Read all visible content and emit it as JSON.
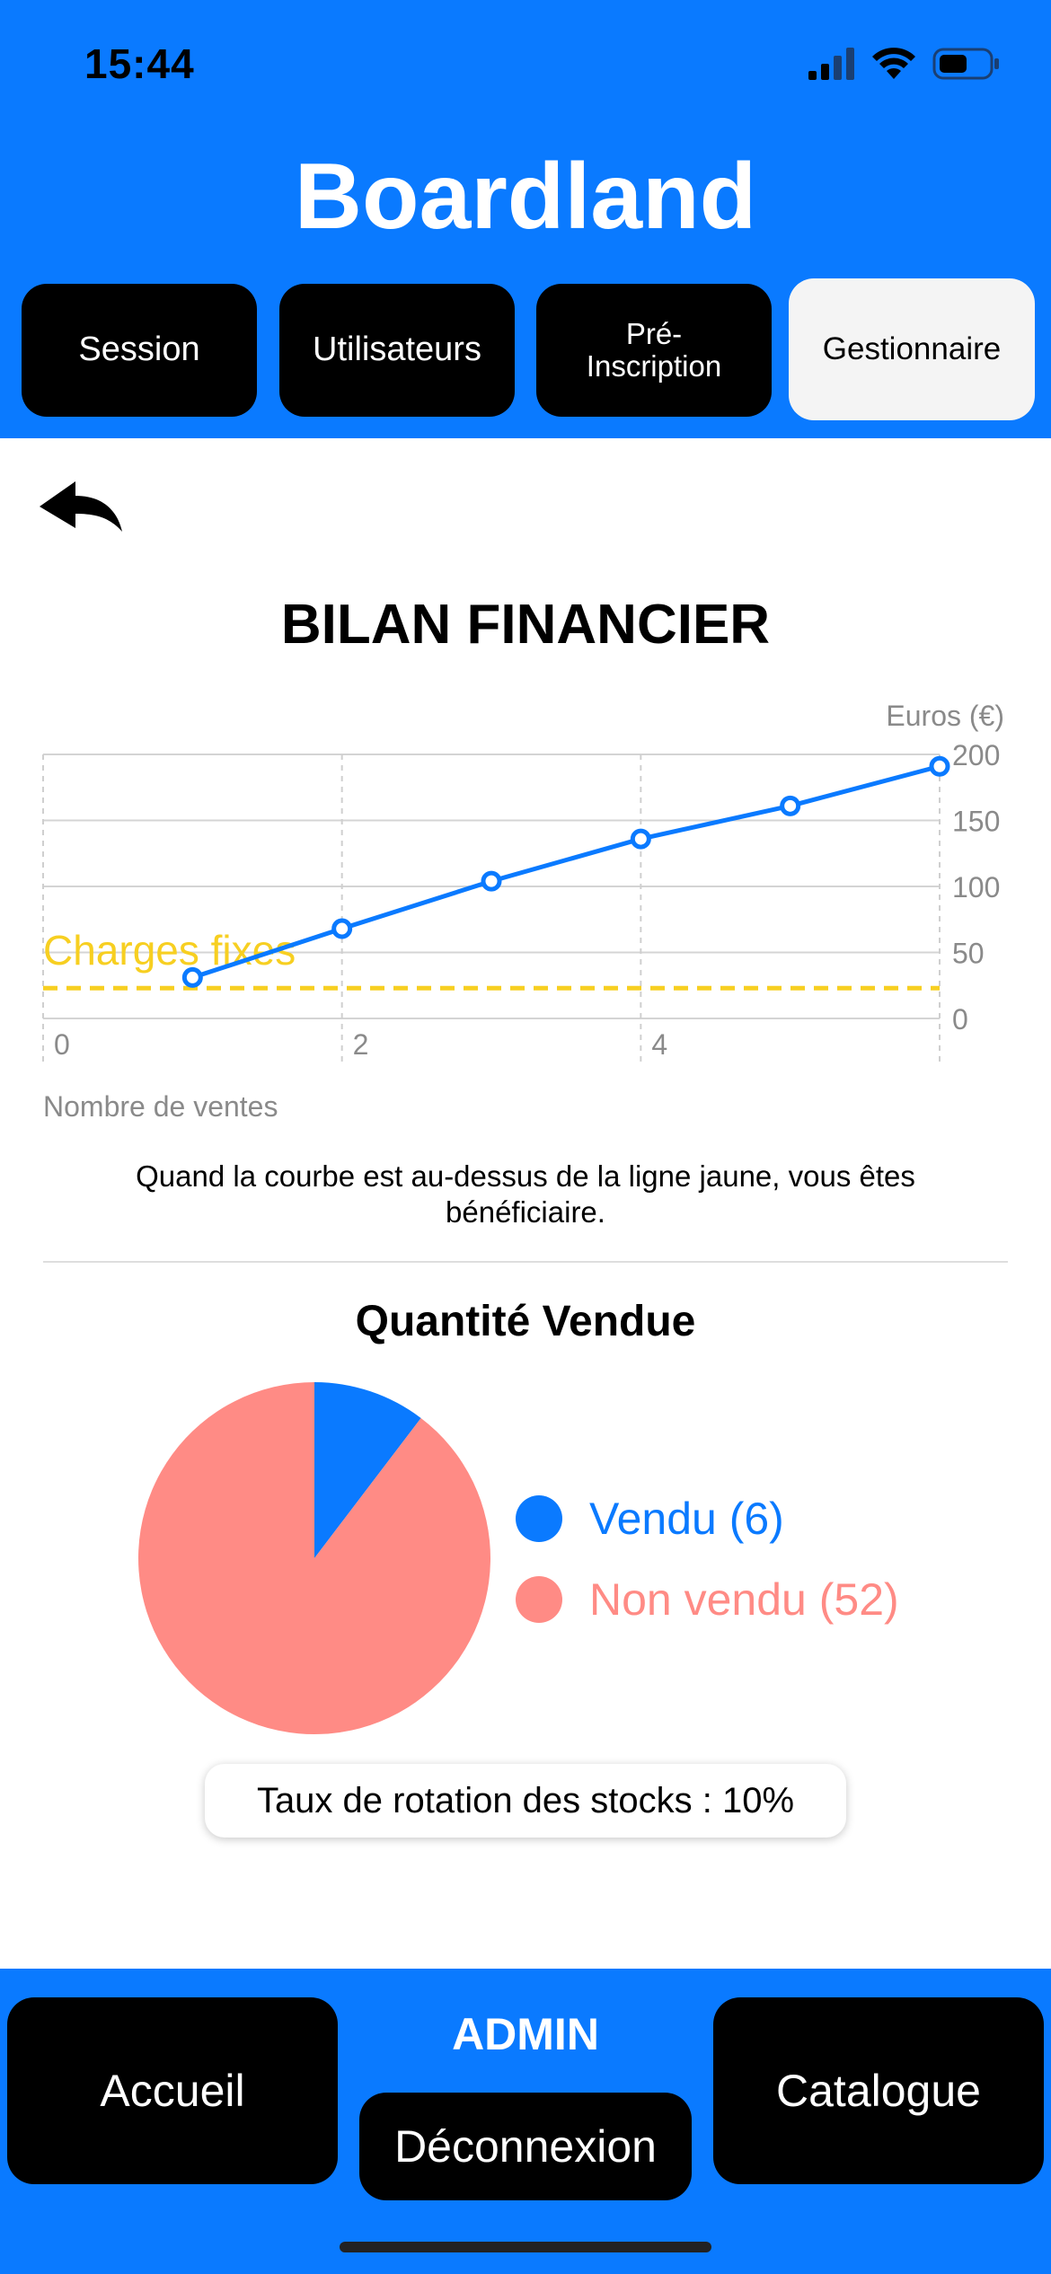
{
  "status_bar": {
    "time": "15:44"
  },
  "app": {
    "title": "Boardland"
  },
  "tabs": [
    {
      "label": "Session"
    },
    {
      "label": "Utilisateurs"
    },
    {
      "label": "Pré-\nInscription"
    },
    {
      "label": "Gestionnaire"
    }
  ],
  "finance": {
    "title": "BILAN FINANCIER",
    "caption": "Quand la courbe est au-dessus de la ligne jaune, vous êtes bénéficiaire."
  },
  "chart_data": [
    {
      "type": "line",
      "ylabel": "Euros (€)",
      "xlabel": "Nombre de ventes",
      "x_ticks": [
        0,
        2,
        4
      ],
      "y_ticks": [
        0,
        50,
        100,
        150,
        200
      ],
      "xlim": [
        0,
        6
      ],
      "ylim": [
        0,
        200
      ],
      "series": [
        {
          "x": [
            1,
            2,
            3,
            4,
            5,
            6
          ],
          "values": [
            31,
            68,
            104,
            136,
            161,
            191
          ],
          "color": "#0a7aff"
        }
      ],
      "reference_line": {
        "label": "Charges fixes",
        "value": 23,
        "color": "#f7cf21"
      },
      "grid": true
    },
    {
      "type": "pie",
      "title": "Quantité Vendue",
      "slices": [
        {
          "label": "Vendu (6)",
          "value": 6,
          "color": "#0a7aff"
        },
        {
          "label": "Non vendu (52)",
          "value": 52,
          "color": "#ff8b85"
        }
      ]
    }
  ],
  "stock_rate": {
    "text": "Taux de rotation des stocks : 10%"
  },
  "footer": {
    "role": "ADMIN",
    "home_label": "Accueil",
    "logout_label": "Déconnexion",
    "catalog_label": "Catalogue"
  },
  "colors": {
    "primary": "#0a7aff",
    "accent_yellow": "#f7cf21",
    "pie_unsold": "#ff8b85"
  },
  "icons": {
    "back": "back-arrow-icon",
    "signal": "signal-icon",
    "wifi": "wifi-icon",
    "battery": "battery-icon"
  }
}
